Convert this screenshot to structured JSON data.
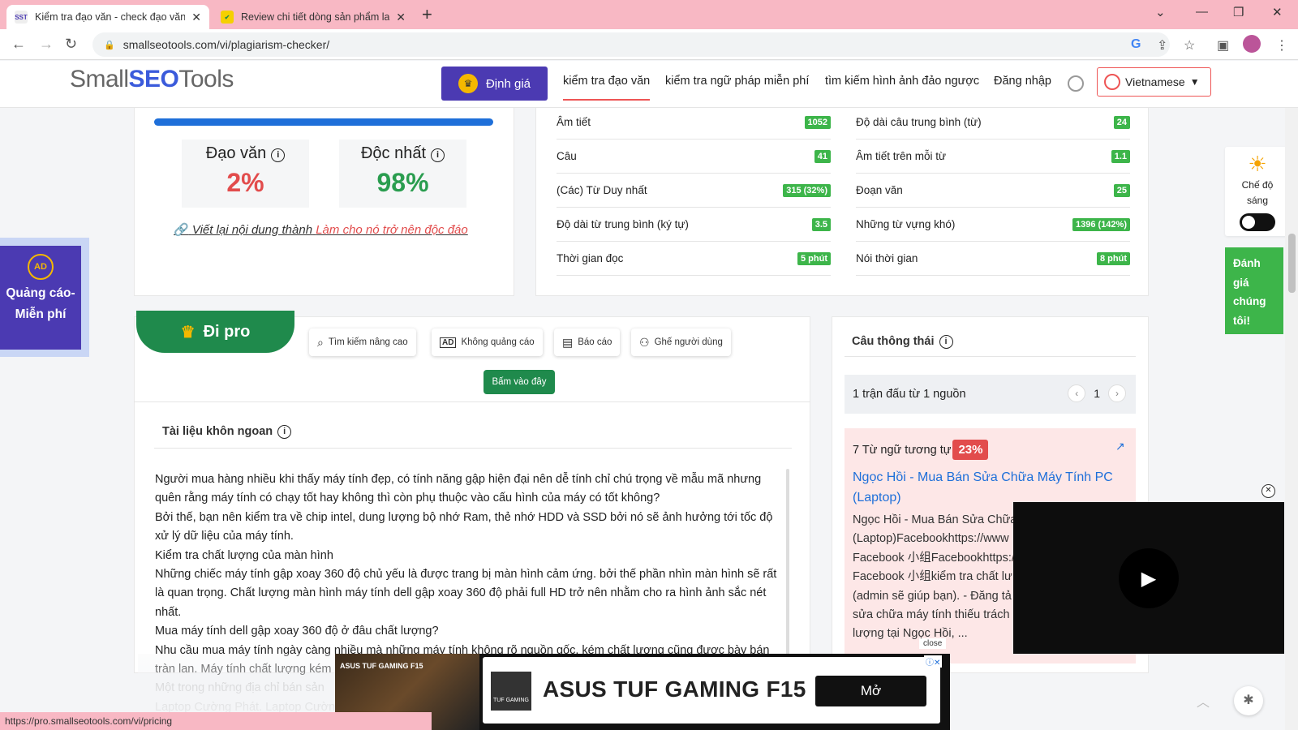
{
  "browser": {
    "tabs": [
      {
        "label": "Kiểm tra đạo văn - check đạo văn",
        "favicon": "SST",
        "active": true
      },
      {
        "label": "Review chi tiết dòng sản phẩm la",
        "favicon": "✔",
        "active": false
      }
    ],
    "url": "smallseotools.com/vi/plagiarism-checker/",
    "status_url": "https://pro.smallseotools.com/vi/pricing"
  },
  "header": {
    "logo_left": "Small",
    "logo_mid": "SEO",
    "logo_right": "Tools",
    "pricing_label": "Định giá",
    "nav": [
      "kiểm tra đạo văn",
      "kiểm tra ngữ pháp miễn phí",
      "tìm kiếm hình ảnh đảo ngược",
      "Đăng nhập"
    ],
    "language": "Vietnamese"
  },
  "result": {
    "plagiarism_label": "Đạo văn",
    "plagiarism_value": "2%",
    "unique_label": "Độc nhất",
    "unique_value": "98%",
    "rewrite_prefix": "Viết lại nội dung thành",
    "rewrite_link": "Làm cho nó trở nên độc đáo",
    "colors": {
      "plagiarism": "#e24c4c",
      "unique": "#2a9d4f"
    }
  },
  "stats": {
    "left": [
      {
        "label": "Âm tiết",
        "value": "1052"
      },
      {
        "label": "Câu",
        "value": "41"
      },
      {
        "label": "(Các) Từ Duy nhất",
        "value": "315 (32%)"
      },
      {
        "label": "Độ dài từ trung bình (ký tự)",
        "value": "3.5"
      },
      {
        "label": "Thời gian đọc",
        "value": "5 phút"
      }
    ],
    "right": [
      {
        "label": "Độ dài câu trung bình (từ)",
        "value": "24"
      },
      {
        "label": "Âm tiết trên mỗi từ",
        "value": "1.1"
      },
      {
        "label": "Đoạn văn",
        "value": "25"
      },
      {
        "label": "Những từ vựng khó)",
        "value": "1396 (142%)"
      },
      {
        "label": "Nói thời gian",
        "value": "8 phút"
      }
    ]
  },
  "ad_left": {
    "label": "Quảng cáo-Miễn phí",
    "icon": "AD"
  },
  "pro": {
    "ribbon": "Đi pro",
    "features": [
      {
        "icon": "search-icon",
        "label": "Tìm kiếm nâng cao"
      },
      {
        "icon": "no-ads-icon",
        "label": "Không quảng cáo"
      },
      {
        "icon": "report-icon",
        "label": "Báo cáo"
      },
      {
        "icon": "users-icon",
        "label": "Ghế người dùng"
      }
    ],
    "cta": "Bấm vào đây"
  },
  "document": {
    "title": "Tài liệu khôn ngoan",
    "paragraphs": [
      "Người mua hàng nhiều khi thấy máy tính đẹp, có tính năng gập hiện đại nên dễ tính chỉ chú trọng về mẫu mã nhưng quên rằng máy tính có chạy tốt hay không thì còn phụ thuộc vào cấu hình của máy có tốt không?",
      "Bởi thế, bạn nên kiểm tra về chip intel, dung lượng bộ nhớ Ram, thẻ nhớ HDD và SSD bởi nó sẽ ảnh hưởng tới tốc độ xử lý dữ liệu của máy tính.",
      "Kiểm tra chất lượng của màn hình",
      "Những chiếc máy tính gập xoay 360 độ chủ yếu là được trang bị màn hình cảm ứng. bởi thế phần nhìn màn hình sẽ rất là quan trọng. Chất lượng màn hình máy tính dell gập xoay 360 độ phải full HD trở nên nhằm cho ra hình ảnh sắc nét nhất.",
      "Mua máy tính dell gập xoay 360 độ ở đâu chất lượng?",
      "Nhu cầu mua máy tính ngày càng nhiều mà những máy tính không rõ nguồn gốc, kém chất lượng cũng được bày bán tràn lan. Máy tính chất lượng kém",
      "Một trong những địa chỉ bán sản",
      "Laptop Cường Phát. Laptop Cường"
    ]
  },
  "sentence_panel": {
    "title": "Câu thông thái",
    "match_summary": "1 trận đấu từ 1 nguồn",
    "page": "1",
    "similar_label": "7 Từ ngữ tương tự",
    "similar_pct": "23%",
    "source_title": "Ngọc Hồi - Mua Bán Sửa Chữa Máy Tính PC (Laptop)",
    "snippet": "Ngọc Hồi - Mua Bán Sửa Chữa\n(Laptop)Facebookhttps://www\nFacebook 小组Facebookhttps:/\nFacebook 小组kiểm tra chất lư\n(admin sẽ giúp bạn). - Đăng tả\nsửa chữa máy tính thiếu trách n\nlượng tại Ngọc Hồi, ...",
    "close_label": "close"
  },
  "theme_widget": {
    "label": "Chế độ sáng"
  },
  "rate_widget": {
    "label": "Đánh giá chúng tôi!"
  },
  "bottom_ad": {
    "product": "ASUS TUF GAMING F15",
    "brand_small": "ASUS TUF GAMING F15",
    "cta": "Mở",
    "logo_text": "TUF GAMING"
  }
}
